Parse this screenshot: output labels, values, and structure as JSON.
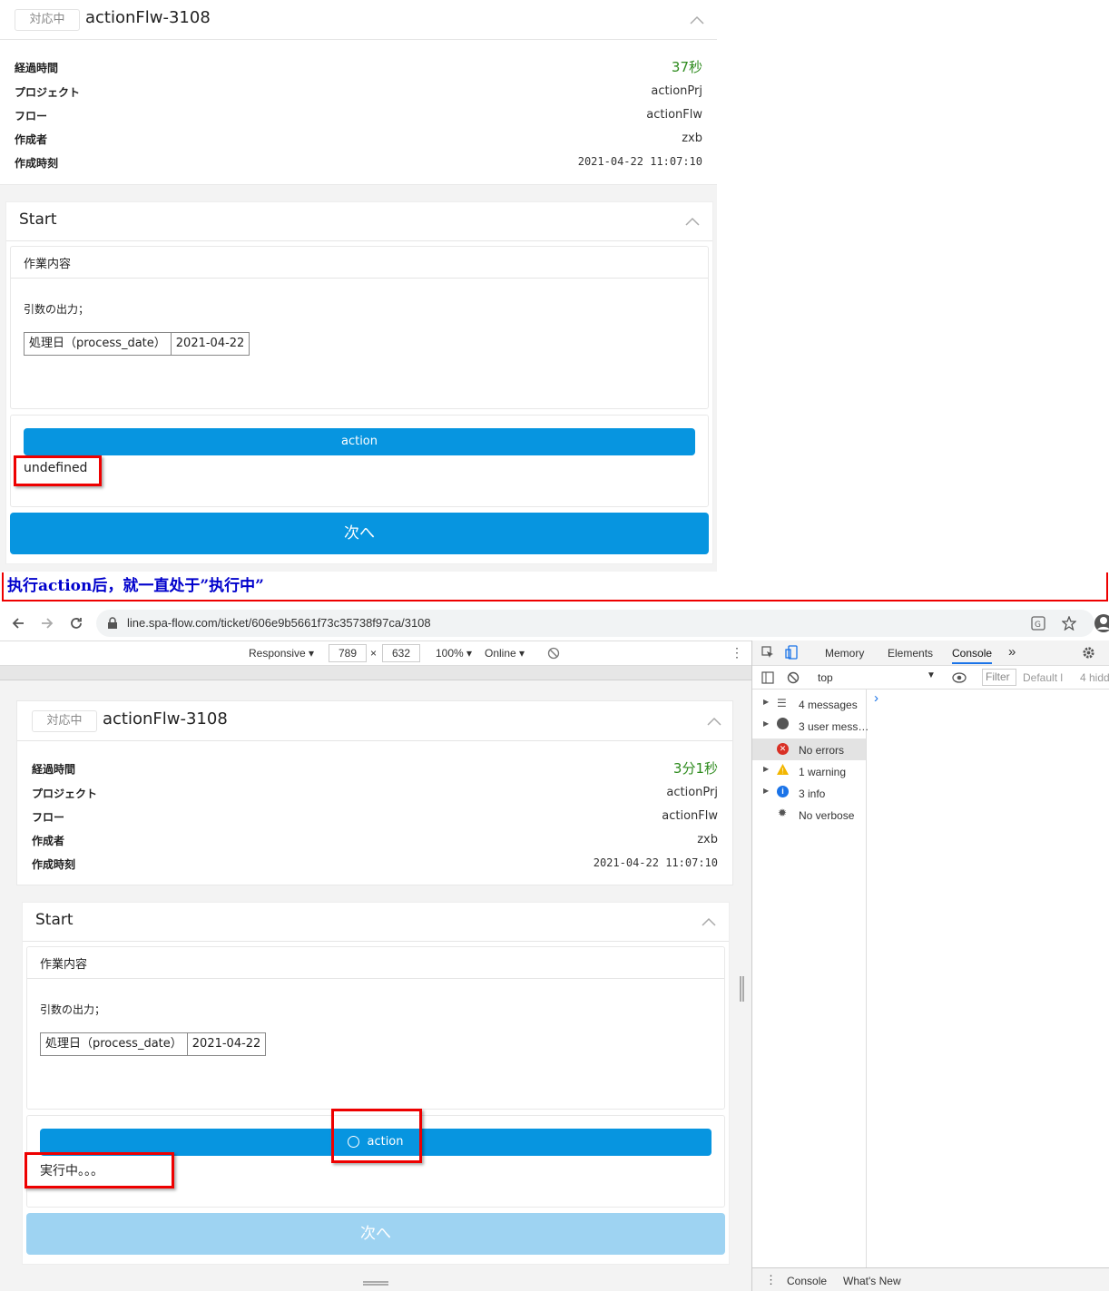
{
  "colors": {
    "accent": "#0795e0",
    "elapsed": "#2e8b1e",
    "highlight": "#e00000",
    "annotation": "#0000cc"
  },
  "top": {
    "badge": "対応中",
    "title": "actionFlw-3108",
    "rows": [
      {
        "label": "経過時間",
        "value": "37秒"
      },
      {
        "label": "プロジェクト",
        "value": "actionPrj"
      },
      {
        "label": "フロー",
        "value": "actionFlw"
      },
      {
        "label": "作成者",
        "value": "zxb"
      },
      {
        "label": "作成時刻",
        "value": "2021-04-22 11:07:10"
      }
    ],
    "step_title": "Start",
    "work_title": "作業内容",
    "args_label": "引数の出力；",
    "table": {
      "key": "処理日（process_date）",
      "value": "2021-04-22"
    },
    "action_label": "action",
    "result": "undefined",
    "next_label": "次へ"
  },
  "annotation": "执行action后，就一直处于”执行中”",
  "browser": {
    "url": "line.spa-flow.com/ticket/606e9b5661f73c35738f97ca/3108",
    "device": "Responsive",
    "width": "789",
    "x": "×",
    "height": "632",
    "zoom": "100%",
    "network": "Online"
  },
  "devtools": {
    "tabs": [
      "Memory",
      "Elements",
      "Console"
    ],
    "more": "»",
    "context": "top",
    "filter": "Filter",
    "levels": "Default l",
    "hidden": "4 hidd",
    "sidebar": [
      "4 messages",
      "3 user mess…",
      "No errors",
      "1 warning",
      "3 info",
      "No verbose"
    ],
    "prompt": "›",
    "bottom_tabs": [
      "Console",
      "What's New"
    ]
  },
  "bottom": {
    "badge": "対応中",
    "title": "actionFlw-3108",
    "rows": [
      {
        "label": "経過時間",
        "value": "3分1秒"
      },
      {
        "label": "プロジェクト",
        "value": "actionPrj"
      },
      {
        "label": "フロー",
        "value": "actionFlw"
      },
      {
        "label": "作成者",
        "value": "zxb"
      },
      {
        "label": "作成時刻",
        "value": "2021-04-22 11:07:10"
      }
    ],
    "step_title": "Start",
    "work_title": "作業内容",
    "args_label": "引数の出力；",
    "table": {
      "key": "処理日（process_date）",
      "value": "2021-04-22"
    },
    "action_label": "action",
    "result": "実行中。。。",
    "next_label": "次へ"
  }
}
